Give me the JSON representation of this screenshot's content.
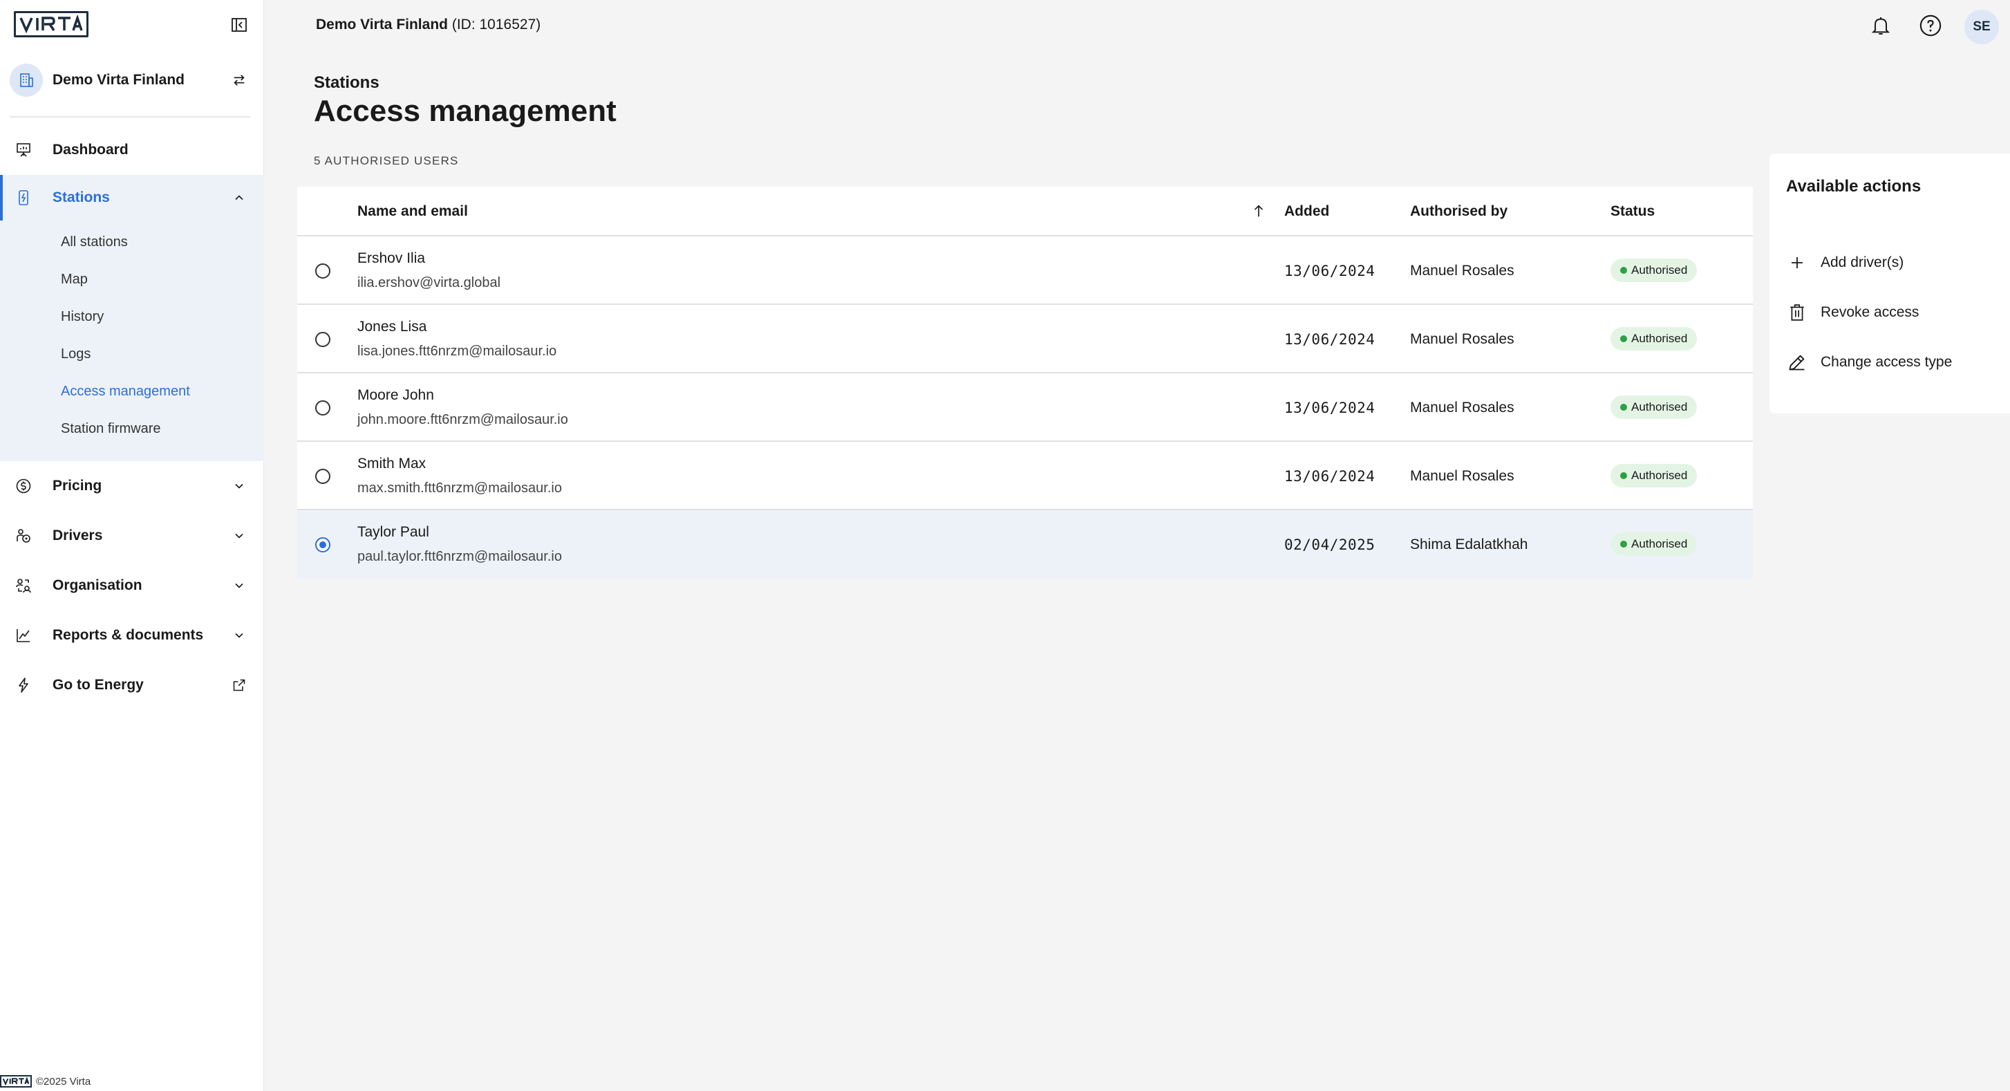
{
  "app": {
    "logo_text": "VIRTA",
    "footer_text": "©2025 Virta"
  },
  "org": {
    "name": "Demo Virta Finland",
    "id_text": "(ID: 1016527)"
  },
  "user": {
    "initials": "SE"
  },
  "sidebar": {
    "nav": [
      {
        "label": "Dashboard",
        "icon": "presentation-icon"
      },
      {
        "label": "Stations",
        "icon": "station-icon",
        "active": true,
        "children": [
          "All stations",
          "Map",
          "History",
          "Logs",
          "Access management",
          "Station firmware"
        ],
        "active_child": "Access management"
      },
      {
        "label": "Pricing",
        "icon": "currency-icon"
      },
      {
        "label": "Drivers",
        "icon": "drivers-icon"
      },
      {
        "label": "Organisation",
        "icon": "organisation-icon"
      },
      {
        "label": "Reports & documents",
        "icon": "chart-icon"
      },
      {
        "label": "Go to Energy",
        "icon": "lightning-icon"
      }
    ]
  },
  "page": {
    "breadcrumb": "Stations",
    "title": "Access management",
    "count_label": "5 AUTHORISED USERS"
  },
  "table": {
    "columns": {
      "name": "Name and email",
      "added": "Added",
      "by": "Authorised by",
      "status": "Status"
    },
    "rows": [
      {
        "name": "Ershov Ilia",
        "email": "ilia.ershov@virta.global",
        "added": "13/06/2024",
        "by": "Manuel Rosales",
        "status": "Authorised",
        "selected": false
      },
      {
        "name": "Jones Lisa",
        "email": "lisa.jones.ftt6nrzm@mailosaur.io",
        "added": "13/06/2024",
        "by": "Manuel Rosales",
        "status": "Authorised",
        "selected": false
      },
      {
        "name": "Moore John",
        "email": "john.moore.ftt6nrzm@mailosaur.io",
        "added": "13/06/2024",
        "by": "Manuel Rosales",
        "status": "Authorised",
        "selected": false
      },
      {
        "name": "Smith Max",
        "email": "max.smith.ftt6nrzm@mailosaur.io",
        "added": "13/06/2024",
        "by": "Manuel Rosales",
        "status": "Authorised",
        "selected": false
      },
      {
        "name": "Taylor Paul",
        "email": "paul.taylor.ftt6nrzm@mailosaur.io",
        "added": "02/04/2025",
        "by": "Shima Edalatkhah",
        "status": "Authorised",
        "selected": true
      }
    ]
  },
  "actions": {
    "title": "Available actions",
    "items": [
      {
        "label": "Add driver(s)",
        "icon": "plus-icon"
      },
      {
        "label": "Revoke access",
        "icon": "trash-icon"
      },
      {
        "label": "Change access type",
        "icon": "pencil-icon"
      }
    ]
  },
  "colors": {
    "accent": "#2d6fd6",
    "status_green": "#2ea043",
    "status_bg": "#e3f4e5",
    "active_bg": "#edf2f9"
  }
}
